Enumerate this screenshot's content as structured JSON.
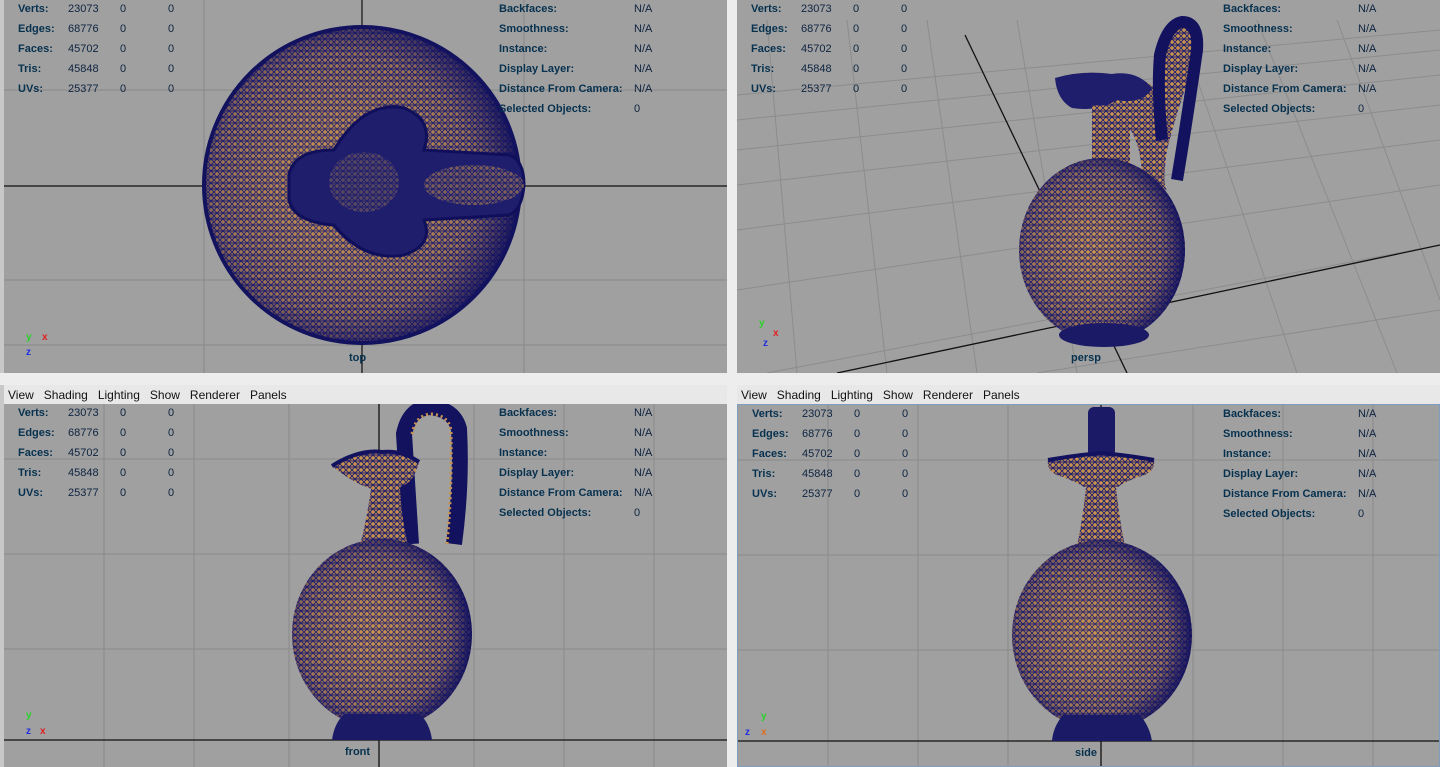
{
  "menu": {
    "items": [
      "View",
      "Shading",
      "Lighting",
      "Show",
      "Renderer",
      "Panels"
    ]
  },
  "hud_left": {
    "rows": [
      {
        "label": "Verts:",
        "v1": "23073",
        "v2": "0",
        "v3": "0"
      },
      {
        "label": "Edges:",
        "v1": "68776",
        "v2": "0",
        "v3": "0"
      },
      {
        "label": "Faces:",
        "v1": "45702",
        "v2": "0",
        "v3": "0"
      },
      {
        "label": "Tris:",
        "v1": "45848",
        "v2": "0",
        "v3": "0"
      },
      {
        "label": "UVs:",
        "v1": "25377",
        "v2": "0",
        "v3": "0"
      }
    ]
  },
  "hud_right": {
    "rows": [
      {
        "label": "Backfaces:",
        "value": "N/A"
      },
      {
        "label": "Smoothness:",
        "value": "N/A"
      },
      {
        "label": "Instance:",
        "value": "N/A"
      },
      {
        "label": "Display Layer:",
        "value": "N/A"
      },
      {
        "label": "Distance From Camera:",
        "value": "N/A"
      },
      {
        "label": "Selected Objects:",
        "value": "0"
      }
    ]
  },
  "viewports": {
    "top": {
      "camera": "top"
    },
    "persp": {
      "camera": "persp"
    },
    "front": {
      "camera": "front"
    },
    "side": {
      "camera": "side"
    }
  },
  "axes": {
    "top": {
      "a": "y",
      "b": "x",
      "c": "z"
    },
    "persp": {
      "a": "y",
      "b": "x",
      "c": "z"
    },
    "front": {
      "a": "y",
      "b": "x",
      "c": "z"
    },
    "side": {
      "a": "y",
      "b": "x",
      "c": "z"
    }
  },
  "colors": {
    "wire": "#1f1f6e",
    "fill": "#b88a4a",
    "grid": "#8a8a8a",
    "axis": "#111111"
  }
}
